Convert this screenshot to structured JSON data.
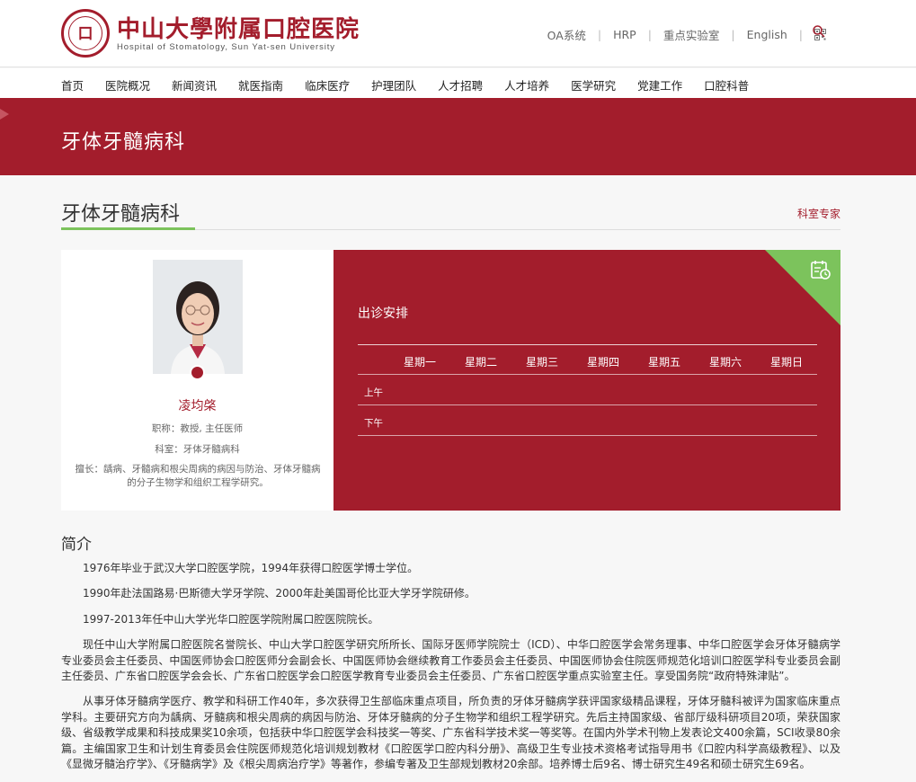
{
  "header": {
    "logo_cn": "中山大學附属口腔医院",
    "logo_en": "Hospital of Stomatology, Sun Yat-sen University",
    "links": [
      "OA系统",
      "HRP",
      "重点实验室",
      "English"
    ],
    "icons": [
      "qr-code-icon",
      "search-icon"
    ],
    "accent_color": "#a31d2c"
  },
  "nav": {
    "items": [
      "首页",
      "医院概况",
      "新闻资讯",
      "就医指南",
      "临床医疗",
      "护理团队",
      "人才招聘",
      "人才培养",
      "医学研究",
      "党建工作",
      "口腔科普"
    ]
  },
  "banner": {
    "title": "牙体牙髓病科"
  },
  "section": {
    "title": "牙体牙髓病科",
    "experts_link": "科室专家",
    "green_color": "#7cc35c"
  },
  "doctor": {
    "name": "凌均棨",
    "title": "职称：教授, 主任医师",
    "department": "科室：牙体牙髓病科",
    "specialty": "擅长：龋病、牙髓病和根尖周病的病因与防治、牙体牙髓病的分子生物学和组织工程学研究。"
  },
  "schedule": {
    "title": "出诊安排",
    "days": [
      "星期一",
      "星期二",
      "星期三",
      "星期四",
      "星期五",
      "星期六",
      "星期日"
    ],
    "periods": [
      "上午",
      "下午"
    ]
  },
  "intro": {
    "title": "简介",
    "paragraphs": [
      "1976年毕业于武汉大学口腔医学院，1994年获得口腔医学博士学位。",
      "1990年赴法国路易·巴斯德大学牙学院、2000年赴美国哥伦比亚大学牙学院研修。",
      "1997-2013年任中山大学光华口腔医学院附属口腔医院院长。",
      "现任中山大学附属口腔医院名誉院长、中山大学口腔医学研究所所长、国际牙医师学院院士（ICD）、中华口腔医学会常务理事、中华口腔医学会牙体牙髓病学专业委员会主任委员、中国医师协会口腔医师分会副会长、中国医师协会继续教育工作委员会主任委员、中国医师协会住院医师规范化培训口腔医学科专业委员会副主任委员、广东省口腔医学会会长、广东省口腔医学会口腔医学教育专业委员会主任委员、广东省口腔医学重点实验室主任。享受国务院“政府特殊津贴”。",
      "从事牙体牙髓病学医疗、教学和科研工作40年，多次获得卫生部临床重点项目，所负责的牙体牙髓病学获评国家级精品课程，牙体牙髓科被评为国家临床重点学科。主要研究方向为龋病、牙髓病和根尖周病的病因与防治、牙体牙髓病的分子生物学和组织工程学研究。先后主持国家级、省部厅级科研项目20项，荣获国家级、省级教学成果和科技成果奖10余项，包括获中华口腔医学会科技奖一等奖、广东省科学技术奖一等奖等。在国内外学术刊物上发表论文400余篇，SCI收录80余篇。主编国家卫生和计划生育委员会住院医师规范化培训规划教材《口腔医学口腔内科分册》、高级卫生专业技术资格考试指导用书《口腔内科学高级教程》、以及《显微牙髓治疗学》、《牙髓病学》及《根尖周病治疗学》等著作，参编专著及卫生部规划教材20余部。培养博士后9名、博士研究生49名和硕士研究生69名。"
    ]
  }
}
